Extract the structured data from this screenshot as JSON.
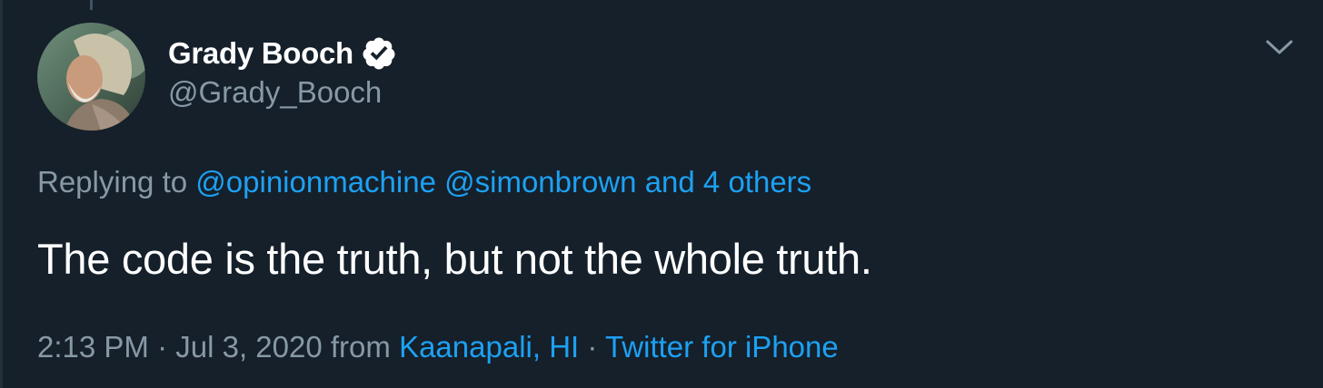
{
  "tweet": {
    "author": {
      "display_name": "Grady Booch",
      "handle": "@Grady_Booch",
      "verified": true,
      "avatar_icon": "user-photo-avatar"
    },
    "reply": {
      "prefix": "Replying to",
      "mentions": [
        "@opinionmachine",
        "@simonbrown"
      ],
      "others": "and 4 others"
    },
    "text": "The code is the truth, but not the whole truth.",
    "meta": {
      "time": "2:13 PM",
      "separator": "·",
      "date": "Jul 3, 2020",
      "from_label": "from",
      "location": "Kaanapali, HI",
      "source": "Twitter for iPhone"
    }
  },
  "colors": {
    "background": "#15202b",
    "primary_text": "#ffffff",
    "secondary_text": "#8899a6",
    "link": "#1da1f2"
  },
  "icons": {
    "verified": "verified-badge-icon",
    "menu": "chevron-down-icon"
  }
}
